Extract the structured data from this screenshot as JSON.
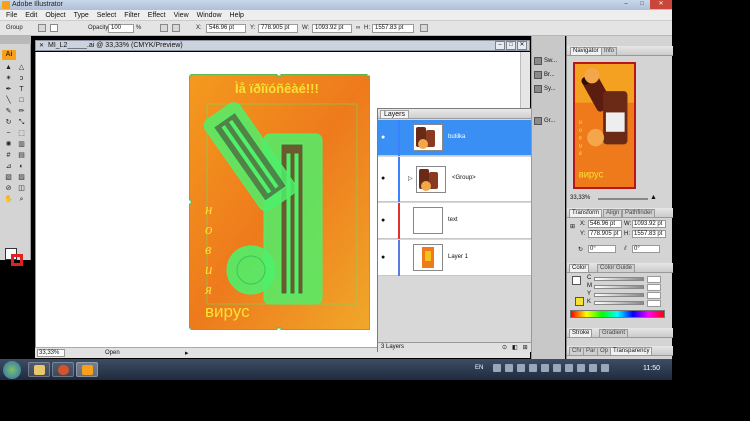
{
  "window": {
    "title": "Adobe Illustrator",
    "buttons": {
      "minimize": "–",
      "maximize": "□",
      "close": "✕"
    }
  },
  "menu": [
    "File",
    "Edit",
    "Object",
    "Type",
    "Select",
    "Filter",
    "Effect",
    "View",
    "Window",
    "Help"
  ],
  "control_bar": {
    "selection": "Group",
    "opacity_label": "Opacity:",
    "opacity_value": "100",
    "opacity_unit": "%",
    "x_label": "X:",
    "x_value": "546.96 pt",
    "y_label": "Y:",
    "y_value": "778.905 pt",
    "w_label": "W:",
    "w_value": "1093.92 pt",
    "h_label": "H:",
    "h_value": "1557.83 pt"
  },
  "document": {
    "tab_title": "MI_L2_____.ai @ 33,33% (CMYK/Preview)",
    "zoom": "33,33%",
    "status": "Open",
    "artwork": {
      "headline": "Ìå ïðîïóñêàé!!!",
      "slogan_vertical": [
        "н",
        "о",
        "в",
        "и",
        "я"
      ],
      "slogan_bottom": "вирус"
    }
  },
  "layers_panel": {
    "tab": "Layers",
    "rows": [
      {
        "name": "butilka",
        "selected": true,
        "color": "#3a80ff"
      },
      {
        "name": "<Group>",
        "selected": false,
        "color": "#3a80ff"
      },
      {
        "name": "text",
        "selected": false,
        "color": "#e03030"
      },
      {
        "name": "Layer 1",
        "selected": false,
        "color": "#5a7ae8"
      }
    ],
    "count": "3 Layers"
  },
  "dock_strip": [
    "Sw...",
    "Br...",
    "Sy...",
    "Gr..."
  ],
  "navigator": {
    "tabs": [
      "Navigator",
      "Info"
    ],
    "zoom": "33,33%",
    "artwork": {
      "vertical_text": [
        "н",
        "о",
        "в",
        "и",
        "я"
      ],
      "bottom_text": "вирус"
    }
  },
  "transform": {
    "tabs": [
      "Transform",
      "Align",
      "Pathfinder"
    ],
    "x_label": "X:",
    "x_value": "546.96 pt",
    "y_label": "Y:",
    "y_value": "778.905 pt",
    "w_label": "W:",
    "w_value": "1093.92 pt",
    "h_label": "H:",
    "h_value": "1557.83 pt",
    "rotate_value": "0°",
    "shear_value": "0°"
  },
  "color_panel": {
    "tabs": [
      "Color",
      "Color Guide"
    ],
    "channels": [
      "C",
      "M",
      "Y",
      "K"
    ]
  },
  "stroke_panel": {
    "tabs": [
      "Stroke",
      "Gradient"
    ]
  },
  "bottom_tabs": [
    "Chr",
    "Par",
    "Op",
    "Transparency"
  ],
  "taskbar": {
    "language": "EN",
    "time": "11:50"
  },
  "colors": {
    "artboard_orange": "#ee7a1c",
    "artboard_yellow": "#f4c21a",
    "selection_green": "#4ff06a",
    "slogan_yellow": "#f7e233",
    "layer_selected": "#3a8ff5"
  }
}
